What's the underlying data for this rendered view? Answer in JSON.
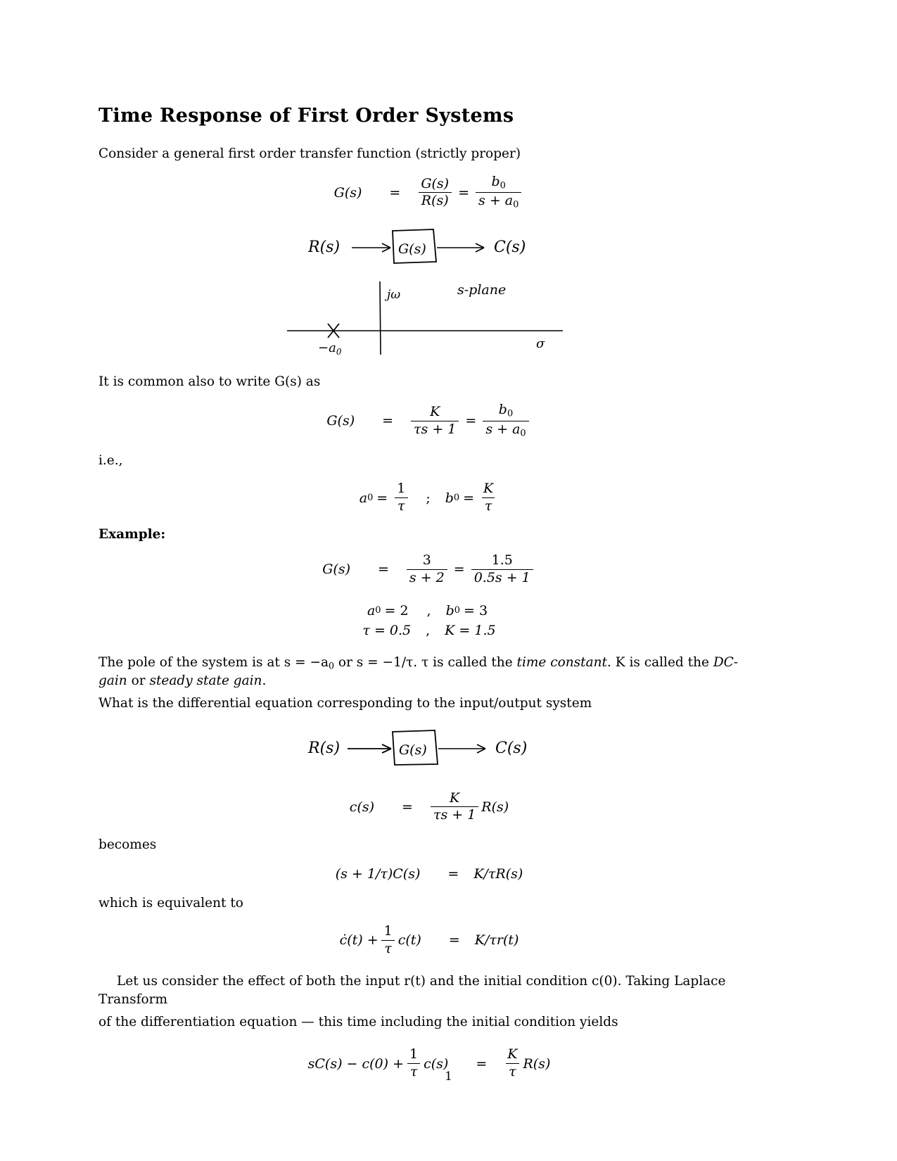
{
  "document": {
    "title": "Time Response of First Order Systems",
    "page_number": "1"
  },
  "paragraphs": {
    "intro": "Consider a general first order transfer function (strictly proper)",
    "common_form": "It is common also to write G(s) as",
    "ie": "i.e.,",
    "example_label": "Example:",
    "pole_text_1": "The pole of the system is at s = −a",
    "pole_text_2": " or s = −1/τ. τ is called the ",
    "pole_emph_1": "time constant",
    "pole_text_3": ". K is called the ",
    "pole_emph_2": "DC-gain",
    "pole_text_4": " or ",
    "pole_emph_3": "steady state gain",
    "pole_text_5": ".",
    "diff_eq_question": "What is the differential equation corresponding to the input/output system",
    "becomes": "becomes",
    "which_is_equivalent": "which is equivalent to",
    "laplace_1": "Let us consider the effect of both the input r(t) and the initial condition c(0). Taking Laplace Transform",
    "laplace_2": "of the differentiation equation — this time including the initial condition yields"
  },
  "equations": {
    "eq1": {
      "lhs": "G(s)",
      "rel1": "=",
      "num1": "G(s)",
      "den1": "R(s)",
      "rel2": "=",
      "num2": "b",
      "num2_sub": "0",
      "den2_a": "s + a",
      "den2_sub": "0"
    },
    "eq2": {
      "lhs": "G(s)",
      "rel1": "=",
      "num1": "K",
      "den1": "τs + 1",
      "rel2": "=",
      "num2": "b",
      "num2_sub": "0",
      "den2_a": "s + a",
      "den2_sub": "0"
    },
    "eq3": {
      "a_sym": "a",
      "a_sub": "0",
      "eq_sign": "=",
      "a_num": "1",
      "a_den": "τ",
      "sep": ";",
      "b_sym": "b",
      "b_sub": "0",
      "b_num": "K",
      "b_den": "τ"
    },
    "eq4": {
      "lhs": "G(s)",
      "rel1": "=",
      "num1": "3",
      "den1": "s + 2",
      "rel2": "=",
      "num2": "1.5",
      "den2": "0.5s + 1"
    },
    "eq5": {
      "line1_left_sym": "a",
      "line1_left_sub": "0",
      "line1_left_val": "= 2",
      "line1_comma": ",",
      "line1_right_sym": "b",
      "line1_right_sub": "0",
      "line1_right_val": "= 3",
      "line2_left": "τ = 0.5",
      "line2_comma": ",",
      "line2_right": "K = 1.5"
    },
    "eq6": {
      "lhs": "c(s)",
      "rel": "=",
      "num": "K",
      "den": "τs + 1",
      "tail": "R(s)"
    },
    "eq7": {
      "lhs": "(s + 1/τ)C(s)",
      "rel": "=",
      "rhs": "K/τR(s)"
    },
    "eq8": {
      "lhs_a": "ċ(t) +",
      "num": "1",
      "den": "τ",
      "lhs_b": "c(t)",
      "rel": "=",
      "rhs": "K/τr(t)"
    },
    "eq9": {
      "lhs_a": "sC(s) − c(0) +",
      "num": "1",
      "den": "τ",
      "lhs_b": "c(s)",
      "rel": "=",
      "rnum": "K",
      "rden": "τ",
      "rtail": "R(s)"
    }
  },
  "figures": {
    "block_diagram_1": {
      "input_label": "R(s)",
      "block_label": "G(s)",
      "output_label": "C(s)"
    },
    "s_plane": {
      "jw_label": "jω",
      "plane_label": "s-plane",
      "pole_marker": "×",
      "pole_label": "−a",
      "pole_sub": "0",
      "sigma_label": "σ"
    },
    "block_diagram_2": {
      "input_label": "R(s)",
      "block_label": "G(s)",
      "output_label": "C(s)"
    }
  },
  "colors": {
    "ink": "#000000",
    "paper": "#ffffff"
  }
}
